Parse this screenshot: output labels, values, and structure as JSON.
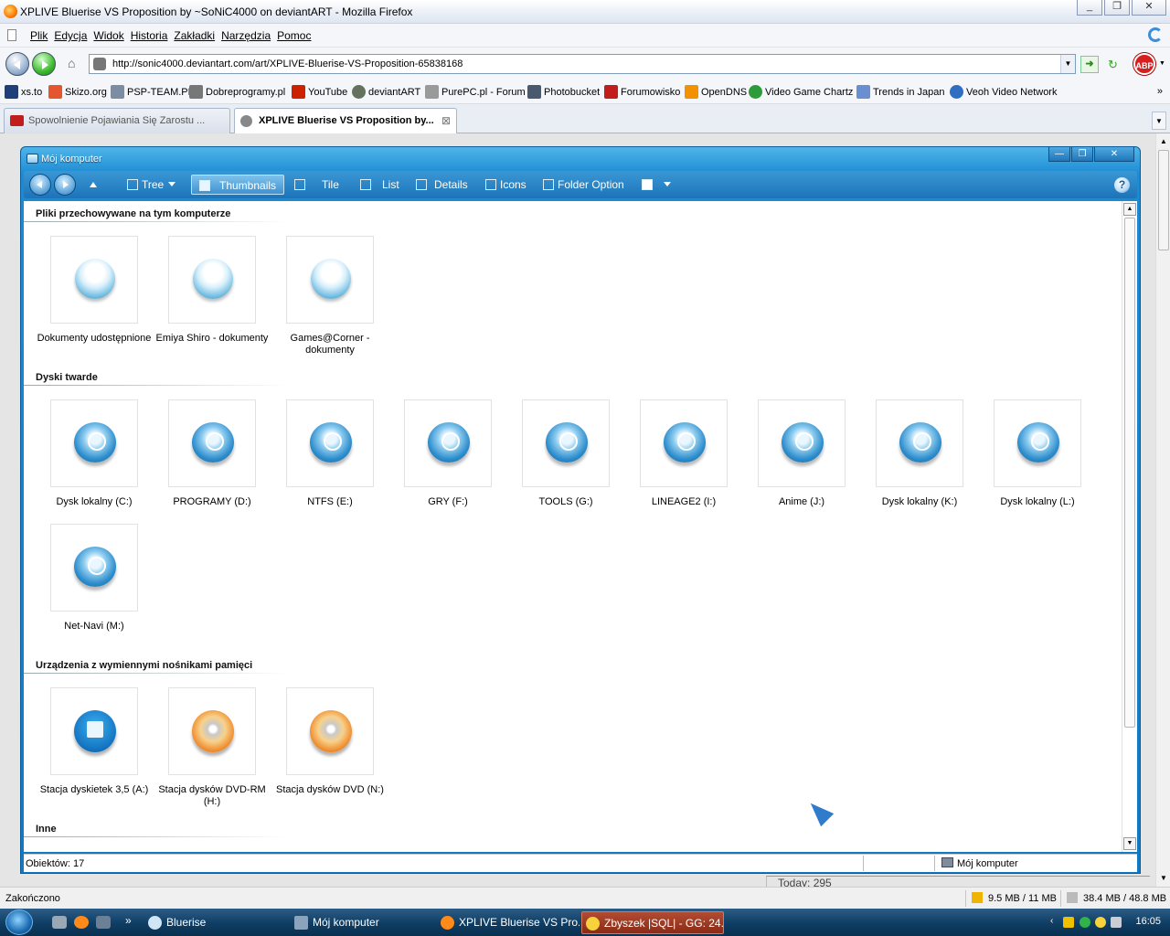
{
  "browser": {
    "window_title": "XPLIVE Bluerise VS Proposition by ~SoNiC4000 on deviantART - Mozilla Firefox",
    "window_buttons": [
      "_",
      "❐",
      "✕"
    ],
    "menu": [
      "Plik",
      "Edycja",
      "Widok",
      "Historia",
      "Zakładki",
      "Narzędzia",
      "Pomoc"
    ],
    "url": "http://sonic4000.deviantart.com/art/XPLIVE-Bluerise-VS-Proposition-65838168",
    "adblock_label": "ABP",
    "bookmarks": [
      {
        "label": "xs.to",
        "icon": "xs-icon",
        "color": "#1e3f7a"
      },
      {
        "label": "Skizo.org",
        "icon": "skizo-icon",
        "color": "#e4572e"
      },
      {
        "label": "PSP-TEAM.PL",
        "icon": "psp-team-icon",
        "color": "#7b8ca3"
      },
      {
        "label": "Dobreprogramy.pl",
        "icon": "dobreprogramy-icon",
        "color": "#777777"
      },
      {
        "label": "YouTube",
        "icon": "youtube-icon",
        "color": "#cc2200"
      },
      {
        "label": "deviantART",
        "icon": "deviantart-icon",
        "color": "#65705f"
      },
      {
        "label": "PurePC.pl - Forum",
        "icon": "purepc-icon",
        "color": "#9a9a9a"
      },
      {
        "label": "Photobucket",
        "icon": "photobucket-icon",
        "color": "#4a5a6e"
      },
      {
        "label": "Forumowisko",
        "icon": "forumowisko-icon",
        "color": "#c21d1d"
      },
      {
        "label": "OpenDNS",
        "icon": "opendns-icon",
        "color": "#f39200"
      },
      {
        "label": "Video Game Chartz",
        "icon": "vgchartz-icon",
        "color": "#2d9b3a"
      },
      {
        "label": "Trends in Japan",
        "icon": "trends-japan-icon",
        "color": "#6a8fd1"
      },
      {
        "label": "Veoh Video Network",
        "icon": "veoh-icon",
        "color": "#2f6fc2"
      }
    ],
    "bookmarks_more": "»",
    "tabs": [
      {
        "label": "Spowolnienie Pojawiania Się Zarostu ..."
      },
      {
        "label": "XPLIVE Bluerise VS Proposition by..."
      }
    ],
    "tab_close": "⊠",
    "status_text": "Zakończono",
    "memory_1": "9.5 MB / 11 MB",
    "memory_2": "38.4 MB / 48.8 MB",
    "page_counter": "Today: 295"
  },
  "explorer": {
    "title": "Mój komputer",
    "window_buttons": [
      "—",
      "❐",
      "✕"
    ],
    "toolbar": {
      "tree": "Tree",
      "thumbnails": "Thumbnails",
      "tile": "Tile",
      "list": "List",
      "details": "Details",
      "icons": "Icons",
      "folder_option": "Folder Option",
      "help": "?"
    },
    "groups": [
      {
        "title": "Pliki przechowywane na tym komputerze",
        "items": [
          {
            "label": "Dokumenty udostępnione",
            "kind": "folder"
          },
          {
            "label": "Emiya Shiro - dokumenty",
            "kind": "folder"
          },
          {
            "label": "Games@Corner - dokumenty",
            "kind": "folder"
          }
        ]
      },
      {
        "title": "Dyski twarde",
        "items": [
          {
            "label": "Dysk lokalny (C:)",
            "kind": "disk"
          },
          {
            "label": "PROGRAMY (D:)",
            "kind": "disk"
          },
          {
            "label": "NTFS (E:)",
            "kind": "disk"
          },
          {
            "label": "GRY (F:)",
            "kind": "disk"
          },
          {
            "label": "TOOLS (G:)",
            "kind": "disk"
          },
          {
            "label": "LINEAGE2 (I:)",
            "kind": "disk"
          },
          {
            "label": "Anime (J:)",
            "kind": "disk"
          },
          {
            "label": "Dysk lokalny (K:)",
            "kind": "disk"
          },
          {
            "label": "Dysk lokalny (L:)",
            "kind": "disk"
          },
          {
            "label": "Net-Navi (M:)",
            "kind": "disk"
          }
        ]
      },
      {
        "title": "Urządzenia z wymiennymi nośnikami pamięci",
        "items": [
          {
            "label": "Stacja dyskietek 3,5 (A:)",
            "kind": "floppy"
          },
          {
            "label": "Stacja dysków DVD-RM (H:)",
            "kind": "dvd"
          },
          {
            "label": "Stacja dysków DVD (N:)",
            "kind": "dvd"
          }
        ]
      },
      {
        "title": "Inne",
        "items": []
      }
    ],
    "status_left": "Obiektów: 17",
    "status_right": "Mój komputer"
  },
  "taskbar": {
    "overflow": "»",
    "tasks": [
      {
        "label": "Bluerise",
        "icon": "bluerise-icon",
        "color": "#cfe6f7"
      },
      {
        "label": "Mój komputer",
        "icon": "computer-icon",
        "color": "#8aa4be"
      },
      {
        "label": "XPLIVE Bluerise VS Pro...",
        "icon": "firefox-icon",
        "color": "#ff8a1a"
      },
      {
        "label": "Zbyszek |SQL| - GG: 24...",
        "icon": "gadu-gadu-icon",
        "color": "#f7d23b",
        "active": true
      }
    ],
    "clock": "16:05"
  }
}
